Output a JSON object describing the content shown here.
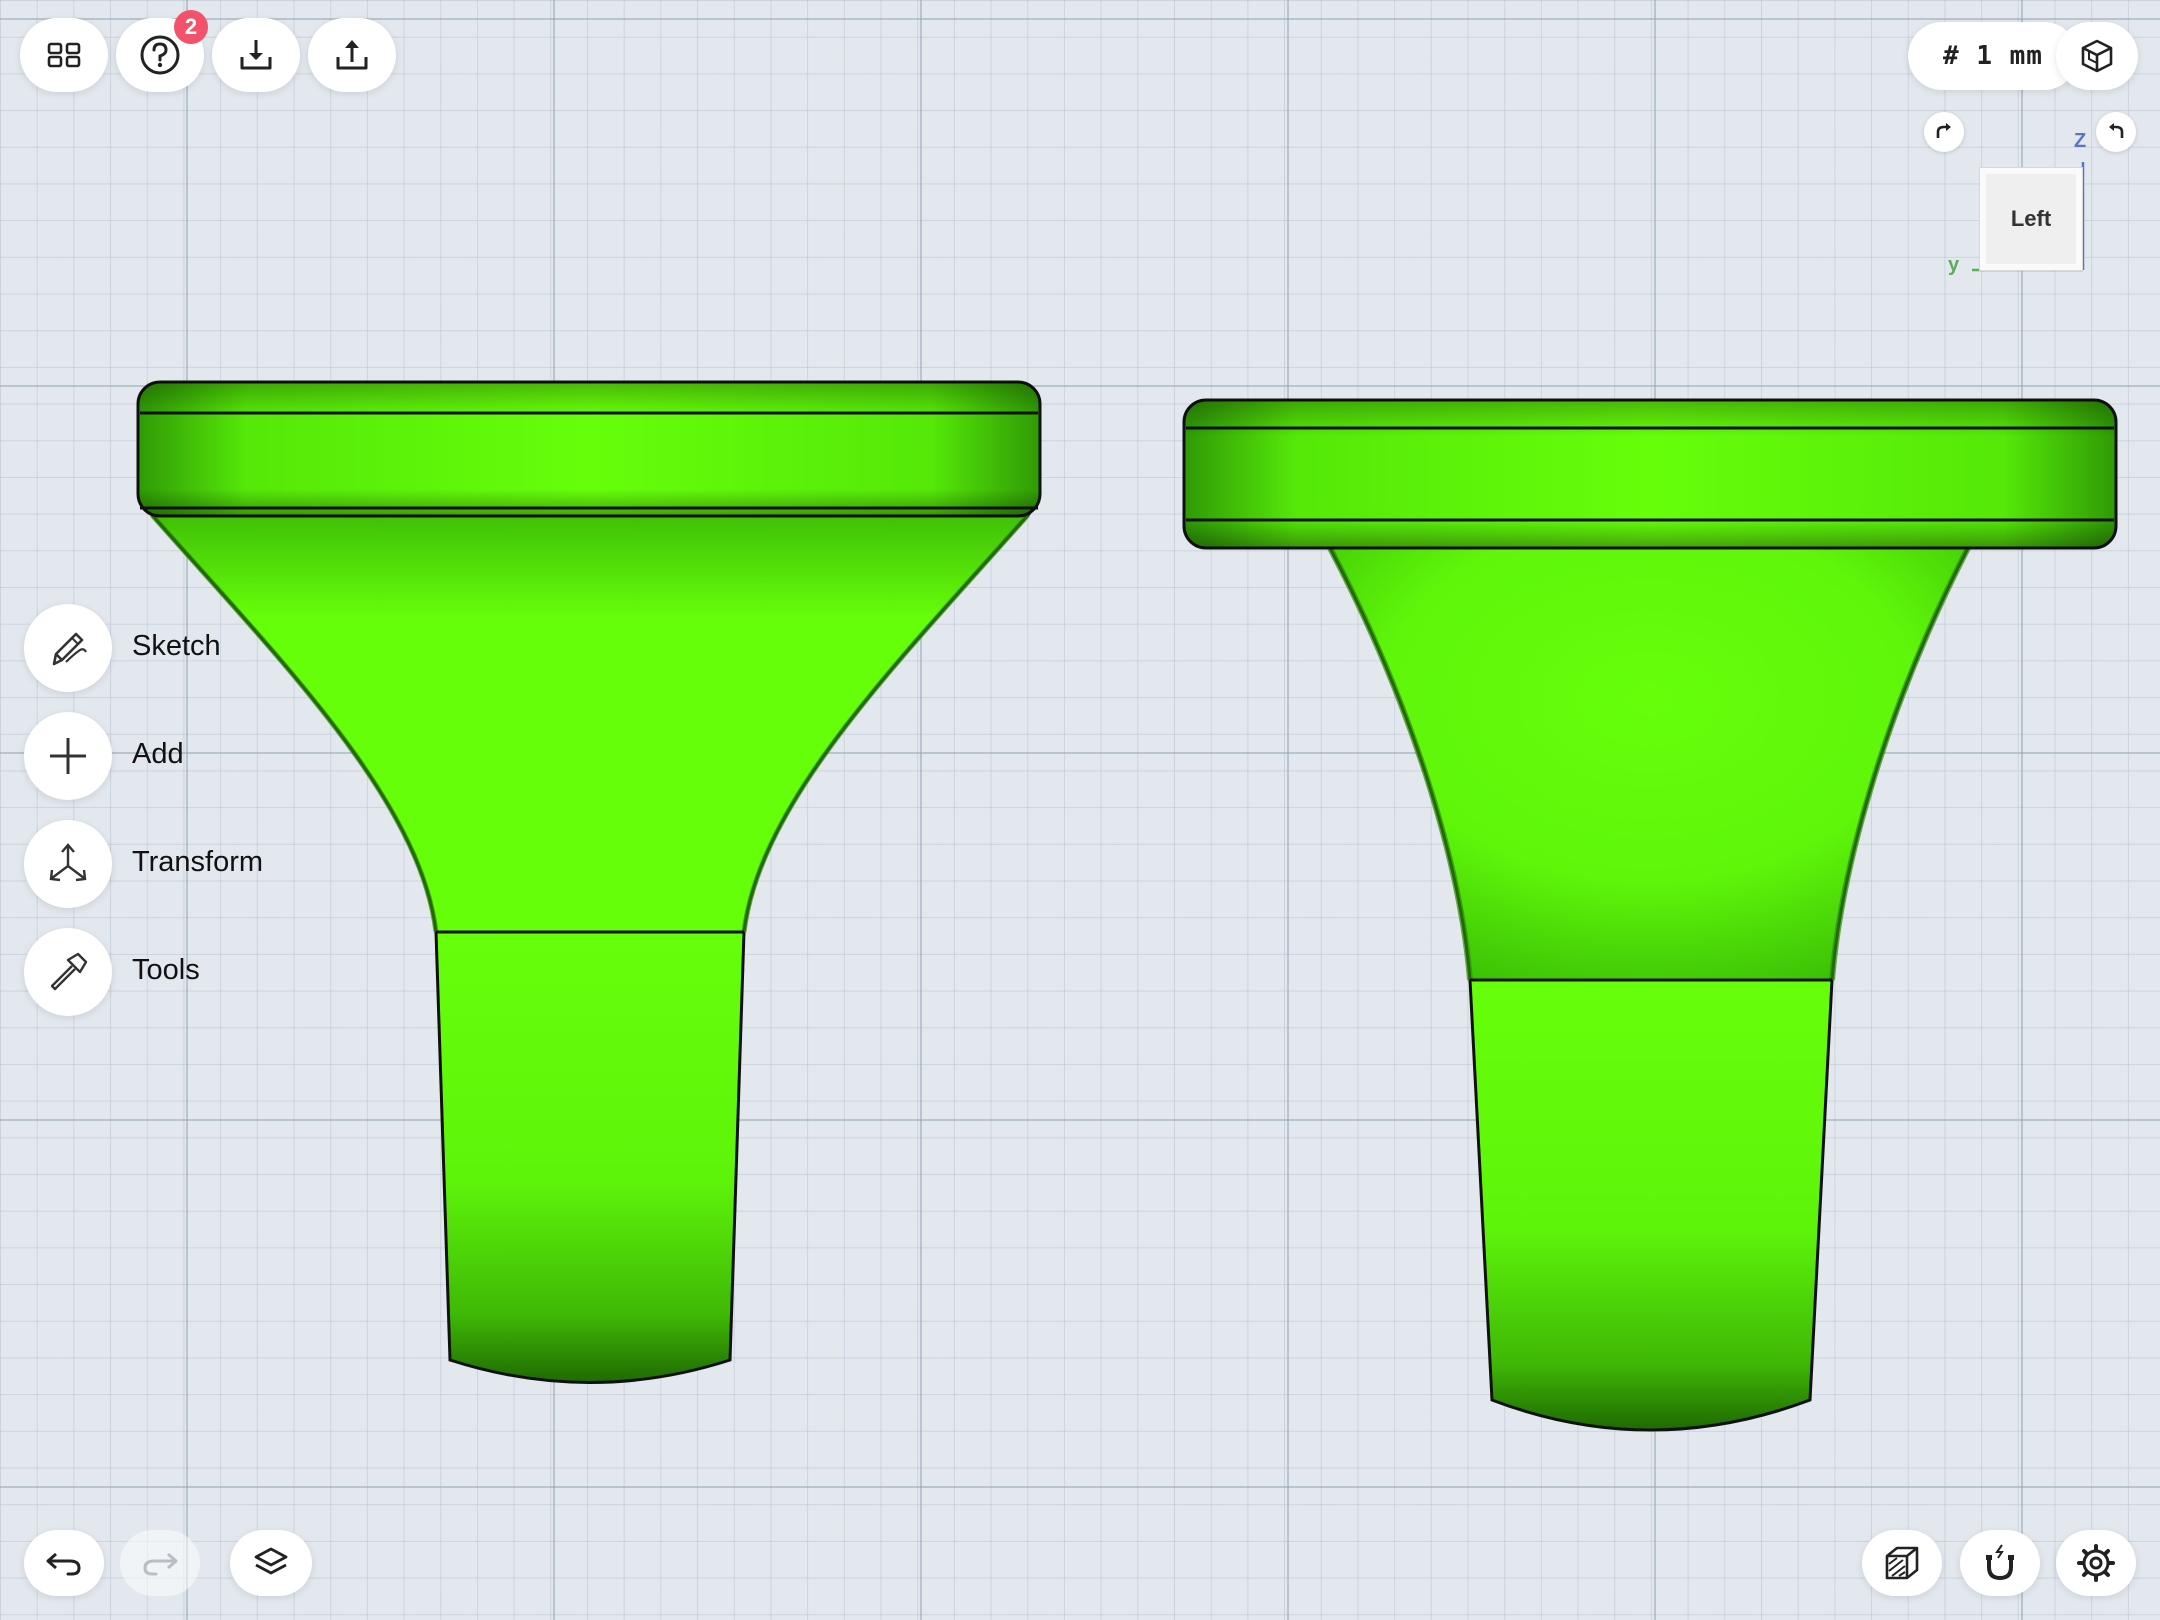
{
  "top_toolbar": {
    "projects_icon": "grid-icon",
    "help_icon": "help-icon",
    "help_badge": "2",
    "import_icon": "import-icon",
    "export_icon": "export-icon"
  },
  "grid": {
    "unit_label": "# 1 mm"
  },
  "view_cube": {
    "face_label": "Left",
    "axis_z": "Z",
    "axis_y": "y",
    "view_mode_icon": "cube-view-icon"
  },
  "side_menu": {
    "items": [
      {
        "label": "Sketch",
        "icon": "pen-icon"
      },
      {
        "label": "Add",
        "icon": "plus-icon"
      },
      {
        "label": "Transform",
        "icon": "transform-icon"
      },
      {
        "label": "Tools",
        "icon": "hammer-icon"
      }
    ]
  },
  "bottom_toolbar": {
    "undo_icon": "undo-icon",
    "redo_icon": "redo-icon",
    "layers_icon": "layers-icon",
    "material_icon": "material-icon",
    "snap_icon": "magnet-icon",
    "settings_icon": "gear-icon"
  },
  "colors": {
    "model_green": "#66ff0a",
    "badge": "#f2536a",
    "axis_z": "#5b74c6",
    "axis_y": "#5aae5a",
    "background": "#e2e8ee"
  }
}
